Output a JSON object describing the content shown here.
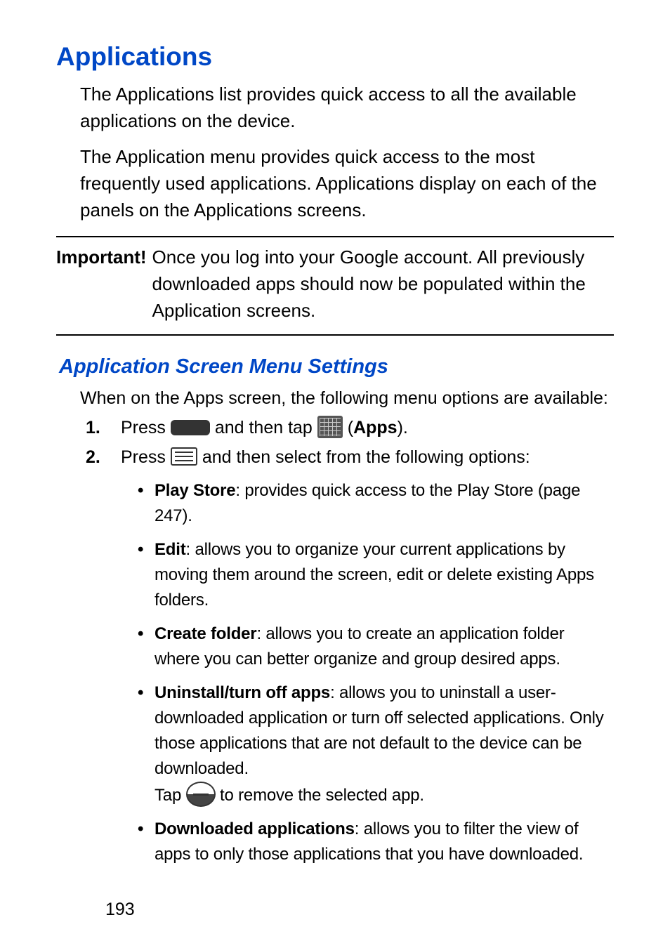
{
  "title": "Applications",
  "intro1": "The Applications list provides quick access to all the available applications on the device.",
  "intro2": "The Application menu provides quick access to the most frequently used applications. Applications display on each of the panels on the Applications screens.",
  "callout": {
    "label": "Important!",
    "body": "Once you log into your Google account. All previously downloaded apps should now be populated within the Application screens."
  },
  "subheading": "Application Screen Menu Settings",
  "lead": "When on the Apps screen, the following menu options are available:",
  "step1": {
    "part1": "Press ",
    "part2": " and then tap ",
    "part3": " (",
    "boldApps": "Apps",
    "part4": ")."
  },
  "step2": {
    "part1": "Press ",
    "part2": " and then select from the following options:"
  },
  "options": {
    "playStore": {
      "b": "Play Store",
      "rest": ": provides quick access to the Play Store (page 247)."
    },
    "edit": {
      "b": "Edit",
      "rest": ": allows you to organize your current applications by moving them around the screen, edit or delete existing Apps folders."
    },
    "createFolder": {
      "b": "Create folder",
      "rest": ": allows you to create an application folder where you can better organize and group desired apps."
    },
    "uninstall": {
      "b": "Uninstall/turn off apps",
      "rest": ": allows you to uninstall a user-downloaded application or turn off selected applications. Only those applications that are not default to the device can be downloaded.",
      "tapPrefix": "Tap ",
      "tapSuffix": " to remove the selected app."
    },
    "downloaded": {
      "b": "Downloaded applications",
      "rest": ": allows you to filter the view of apps to only those applications that you have downloaded."
    }
  },
  "pageNumber": "193"
}
